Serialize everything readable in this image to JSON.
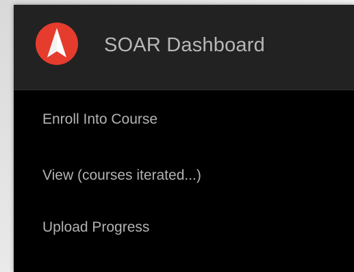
{
  "app": {
    "title": "SOAR Dashboard",
    "logo_icon": "compass-arrow-icon",
    "brand_color": "#e53c2e"
  },
  "menu": {
    "items": [
      {
        "label": "Enroll Into Course"
      },
      {
        "label": "View (courses iterated...)"
      },
      {
        "label": "Upload Progress"
      }
    ]
  },
  "colors": {
    "header_bg": "#222222",
    "menu_bg": "#000000",
    "text": "#b3b3b3"
  }
}
